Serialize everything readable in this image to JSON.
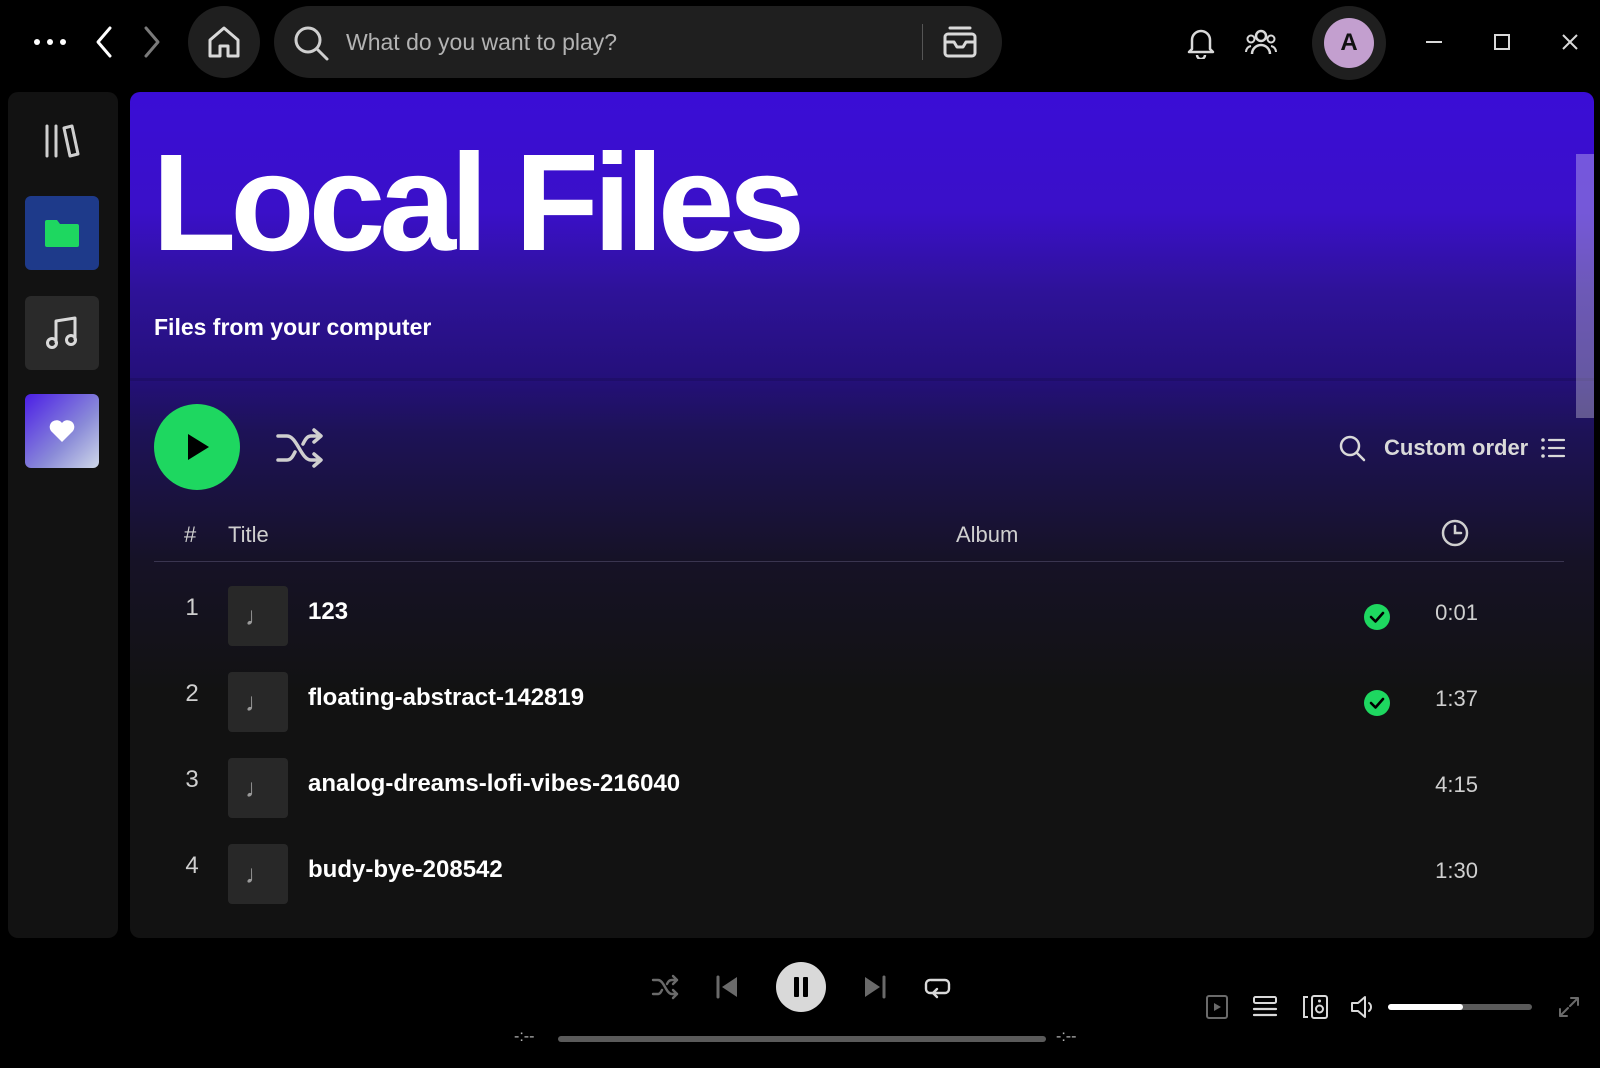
{
  "header": {
    "search_placeholder": "What do you want to play?",
    "avatar_initial": "A"
  },
  "sidebar": {
    "items": [
      {
        "icon": "library-icon"
      },
      {
        "icon": "folder-icon",
        "color": "#1ed760"
      },
      {
        "icon": "music-note-icon"
      },
      {
        "icon": "heart-icon"
      }
    ]
  },
  "playlist": {
    "title": "Local Files",
    "subtitle": "Files from your computer",
    "sort_label": "Custom order",
    "accent": "#1ed760"
  },
  "table": {
    "headers": {
      "number": "#",
      "title": "Title",
      "album": "Album"
    },
    "rows": [
      {
        "number": "1",
        "title": "123",
        "album": "",
        "downloaded": true,
        "duration": "0:01"
      },
      {
        "number": "2",
        "title": "floating-abstract-142819",
        "album": "",
        "downloaded": true,
        "duration": "1:37"
      },
      {
        "number": "3",
        "title": "analog-dreams-lofi-vibes-216040",
        "album": "",
        "downloaded": false,
        "duration": "4:15"
      },
      {
        "number": "4",
        "title": "budy-bye-208542",
        "album": "",
        "downloaded": false,
        "duration": "1:30"
      }
    ]
  },
  "player": {
    "time_elapsed": "-:--",
    "time_total": "-:--",
    "progress": 0,
    "volume": 0.52
  }
}
